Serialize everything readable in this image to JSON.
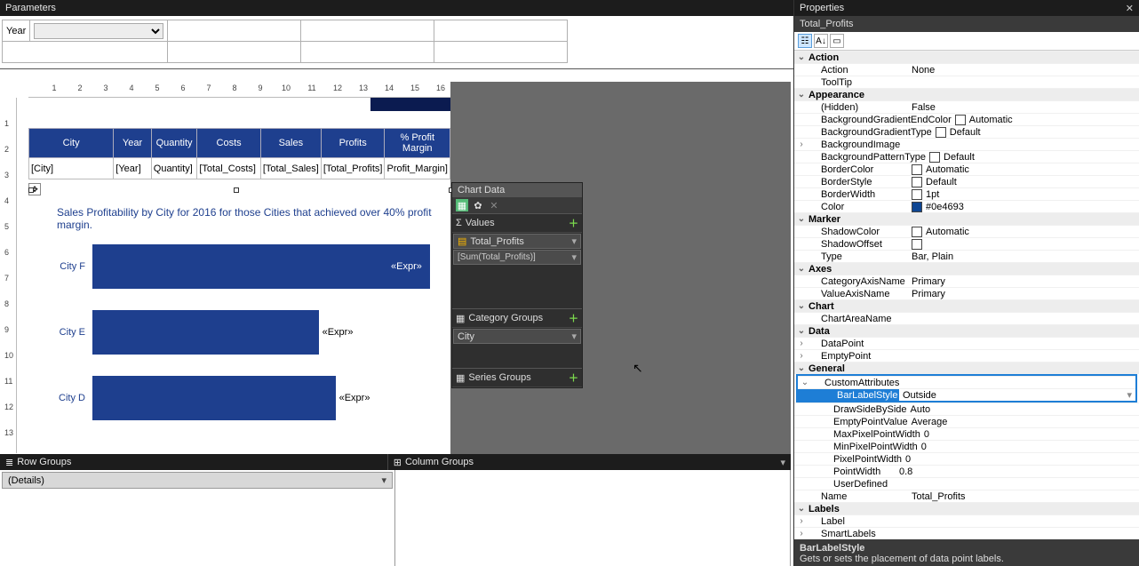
{
  "panes": {
    "parameters_title": "Parameters",
    "properties_title": "Properties"
  },
  "parameters": {
    "fields": {
      "year_label": "Year"
    }
  },
  "ruler_h": [
    "1",
    "2",
    "3",
    "4",
    "5",
    "6",
    "7",
    "8",
    "9",
    "10",
    "11",
    "12",
    "13",
    "14",
    "15",
    "16"
  ],
  "report_table": {
    "headers": [
      "City",
      "Year",
      "Quantity",
      "Costs",
      "Sales",
      "Profits",
      "% Profit Margin"
    ],
    "row": [
      "[City]",
      "[Year]",
      "Quantity]",
      "[Total_Costs]",
      "[Total_Sales]",
      "[Total_Profits]",
      "Profit_Margin]"
    ]
  },
  "chart_title": "Sales Profitability by City for 2016 for those Cities that achieved over 40% profit margin.",
  "chart_data": {
    "type": "bar",
    "orientation": "horizontal",
    "categories": [
      "City F",
      "City E",
      "City D"
    ],
    "values": [
      100,
      67,
      72
    ],
    "bar_label": "«Expr»",
    "series_name": "Total_Profits",
    "xlim": [
      0,
      100
    ],
    "note": "Design-time preview bars; values approximate relative widths"
  },
  "chart_data_panel": {
    "title": "Chart Data",
    "sections": {
      "values": {
        "label": "Values",
        "item_name": "Total_Profits",
        "item_expr": "[Sum(Total_Profits)]"
      },
      "category_groups": {
        "label": "Category Groups",
        "item_name": "City"
      },
      "series_groups": {
        "label": "Series Groups"
      }
    }
  },
  "groups": {
    "row_label": "Row Groups",
    "col_label": "Column Groups",
    "details_label": "(Details)"
  },
  "properties": {
    "object_name": "Total_Profits",
    "help": {
      "name": "BarLabelStyle",
      "desc": "Gets or sets the placement of data point labels."
    },
    "cats": {
      "action": "Action",
      "appearance": "Appearance",
      "marker": "Marker",
      "axes": "Axes",
      "chart": "Chart",
      "data": "Data",
      "general": "General",
      "labels": "Labels"
    },
    "rows": {
      "action": {
        "n": "Action",
        "v": "None"
      },
      "tooltip": {
        "n": "ToolTip",
        "v": ""
      },
      "hidden": {
        "n": "(Hidden)",
        "v": "False"
      },
      "bgGradEndColor": {
        "n": "BackgroundGradientEndColor",
        "v": "Automatic",
        "sw": "#ffffff"
      },
      "bgGradType": {
        "n": "BackgroundGradientType",
        "v": "Default",
        "sw": "#ffffff"
      },
      "bgImage": {
        "n": "BackgroundImage",
        "v": ""
      },
      "bgPattern": {
        "n": "BackgroundPatternType",
        "v": "Default",
        "sw": "#ffffff"
      },
      "borderColor": {
        "n": "BorderColor",
        "v": "Automatic",
        "sw": "#ffffff"
      },
      "borderStyle": {
        "n": "BorderStyle",
        "v": "Default",
        "sw": "#ffffff"
      },
      "borderWidth": {
        "n": "BorderWidth",
        "v": "1pt",
        "sw": "#ffffff"
      },
      "color": {
        "n": "Color",
        "v": "#0e4693",
        "sw": "#0e4693"
      },
      "shadowColor": {
        "n": "ShadowColor",
        "v": "Automatic",
        "sw": "#ffffff"
      },
      "shadowOffset": {
        "n": "ShadowOffset",
        "v": "",
        "sw": "#ffffff"
      },
      "type": {
        "n": "Type",
        "v": "Bar, Plain"
      },
      "catAxis": {
        "n": "CategoryAxisName",
        "v": "Primary"
      },
      "valAxis": {
        "n": "ValueAxisName",
        "v": "Primary"
      },
      "chartArea": {
        "n": "ChartAreaName",
        "v": ""
      },
      "dataPoint": {
        "n": "DataPoint",
        "v": ""
      },
      "emptyPoint": {
        "n": "EmptyPoint",
        "v": ""
      },
      "customAttr": {
        "n": "CustomAttributes",
        "v": ""
      },
      "barLabelStyle": {
        "n": "BarLabelStyle",
        "v": "Outside"
      },
      "drawSide": {
        "n": "DrawSideBySide",
        "v": "Auto"
      },
      "emptyPointVal": {
        "n": "EmptyPointValue",
        "v": "Average"
      },
      "maxPx": {
        "n": "MaxPixelPointWidth",
        "v": "0"
      },
      "minPx": {
        "n": "MinPixelPointWidth",
        "v": "0"
      },
      "pxWidth": {
        "n": "PixelPointWidth",
        "v": "0"
      },
      "pointWidth": {
        "n": "PointWidth",
        "v": "0.8"
      },
      "userDef": {
        "n": "UserDefined",
        "v": ""
      },
      "name": {
        "n": "Name",
        "v": "Total_Profits"
      },
      "label": {
        "n": "Label",
        "v": ""
      },
      "smartLabels": {
        "n": "SmartLabels",
        "v": ""
      }
    }
  }
}
